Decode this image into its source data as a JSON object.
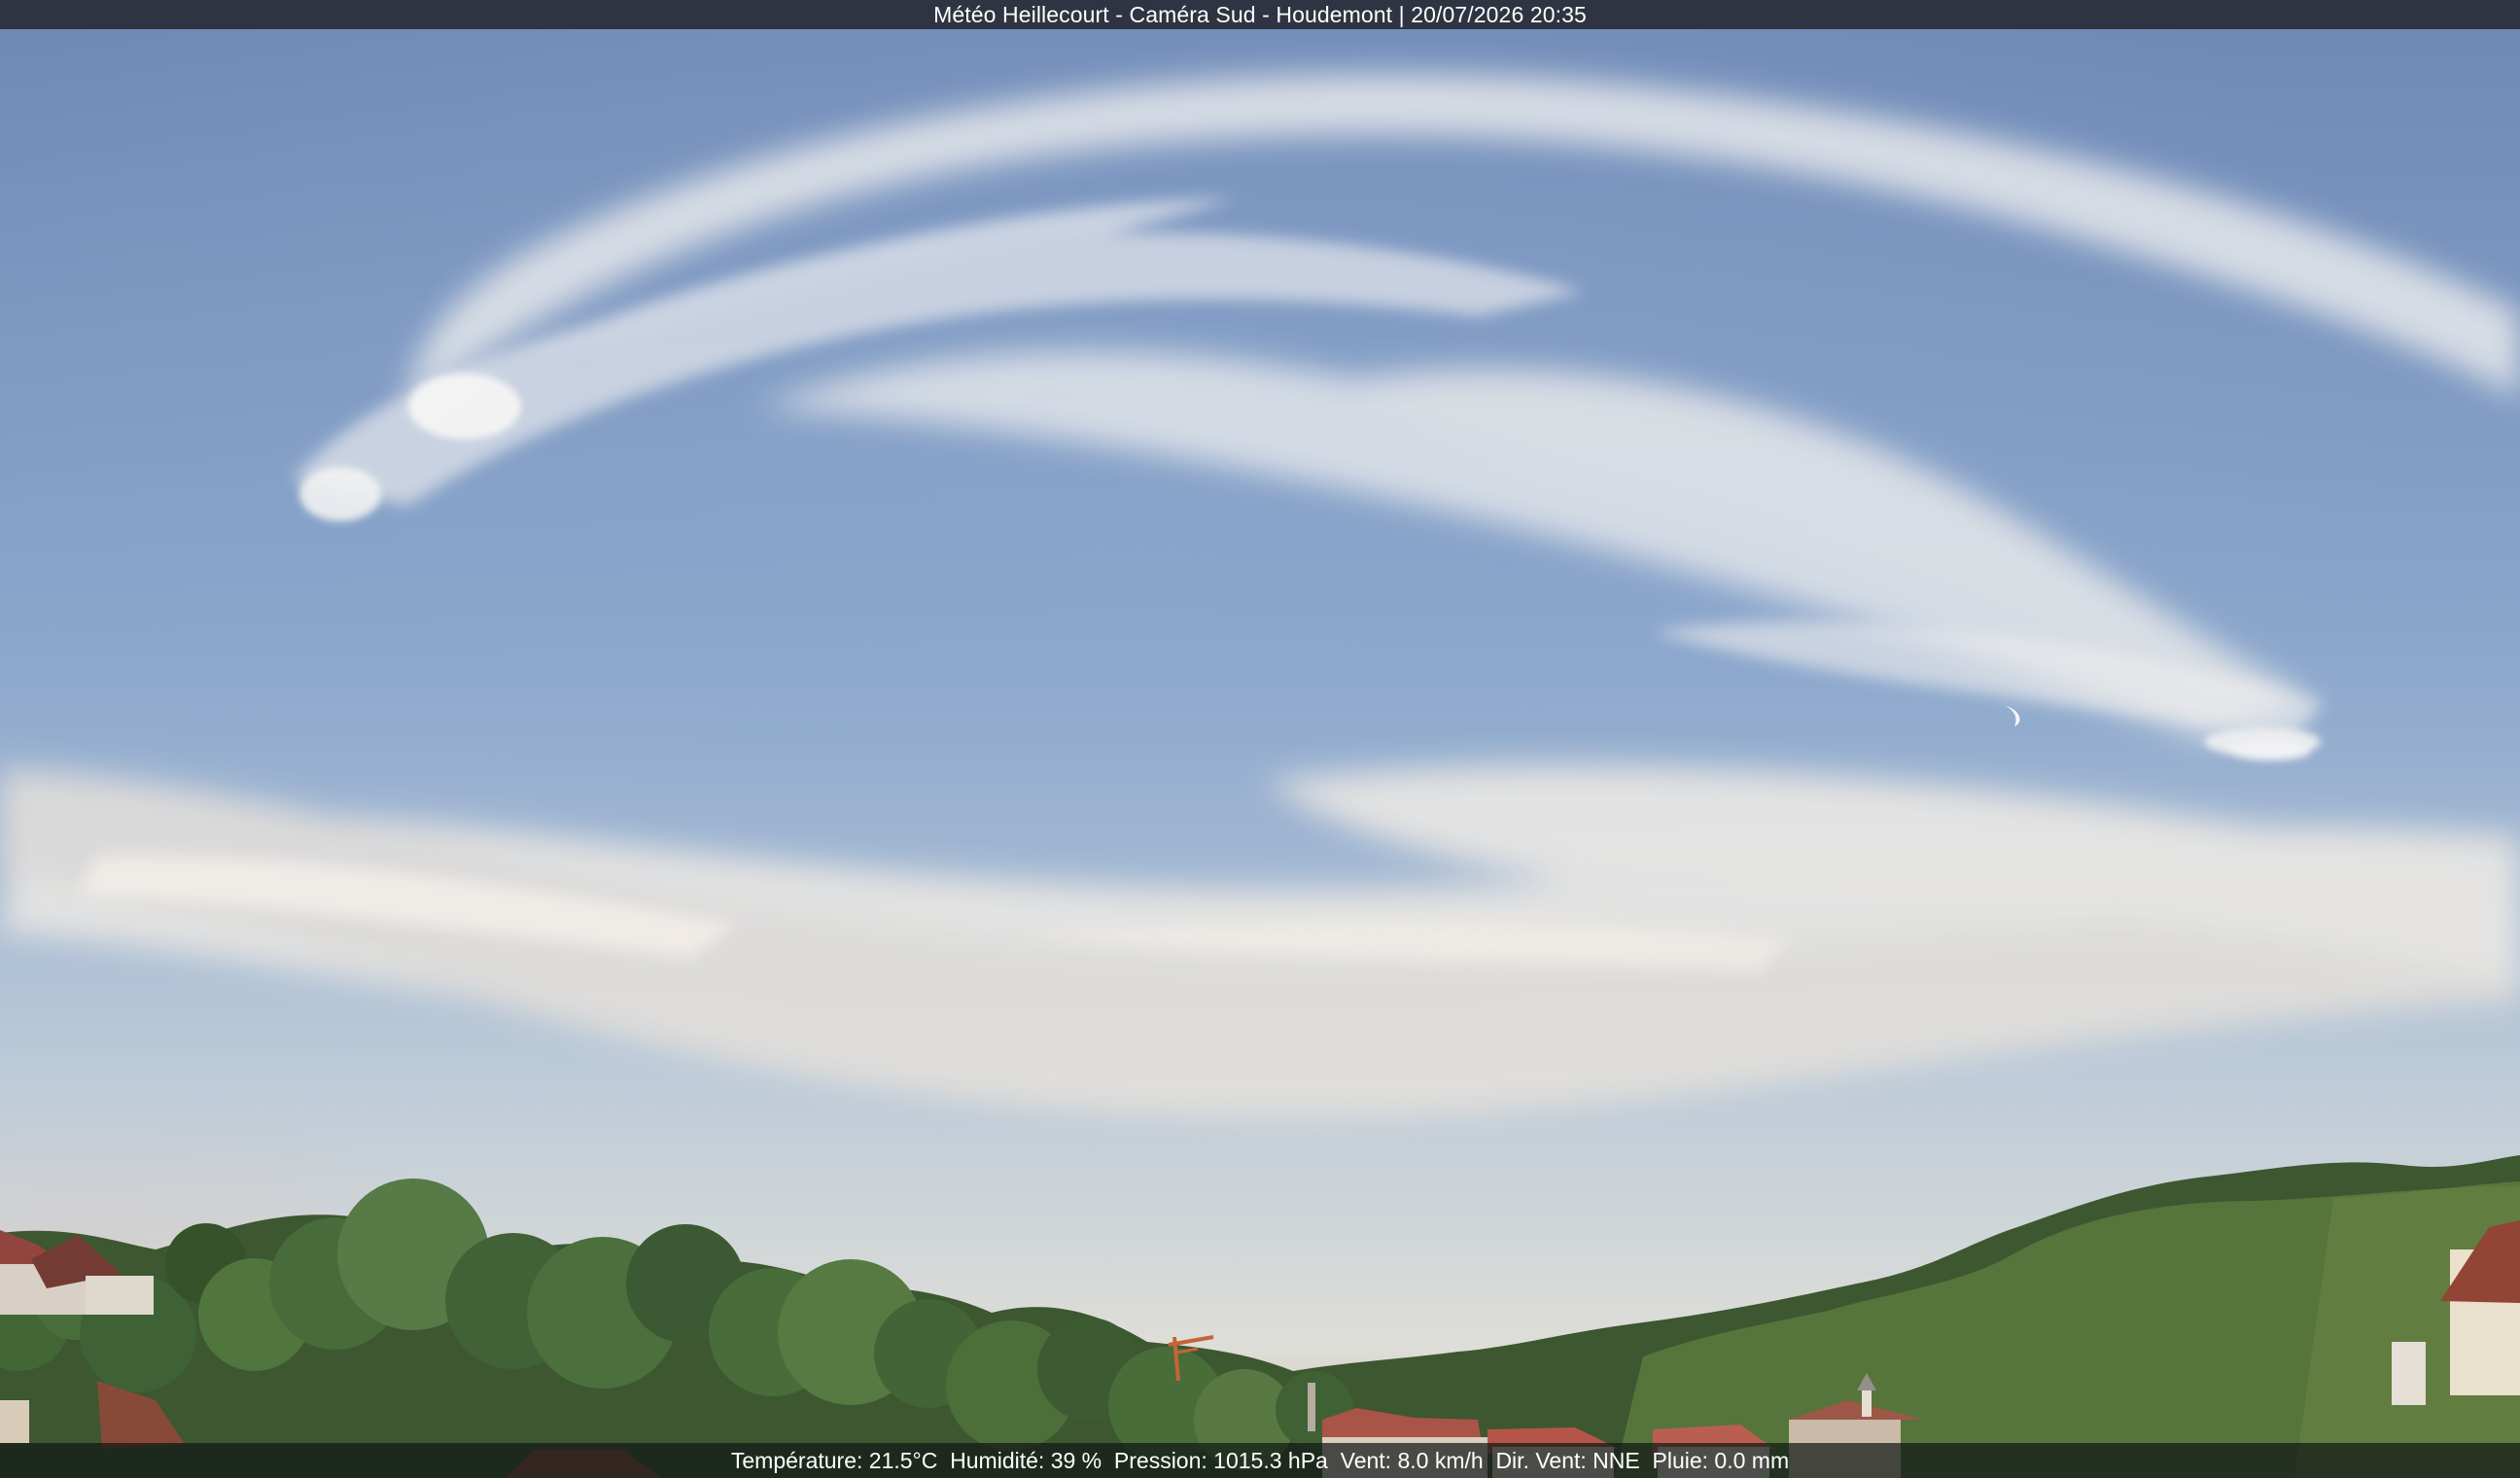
{
  "header": {
    "title": "Météo Heillecourt - Caméra Sud - Houdemont | 20/07/2026 20:35"
  },
  "weather": {
    "temperature": "Température: 21.5°C",
    "humidity": "Humidité: 39 %",
    "pressure": "Pression: 1015.3 hPa",
    "wind_speed": "Vent: 8.0 km/h",
    "wind_direction": "Dir. Vent: NNE",
    "rain": "Pluie: 0.0 mm"
  },
  "colors": {
    "sky_top": "#6e8cbc",
    "sky_middle": "#9db7d4",
    "sky_horizon": "#d8ddd6",
    "clouds": "#f2f0ea",
    "vegetation": "#2f5d26"
  }
}
